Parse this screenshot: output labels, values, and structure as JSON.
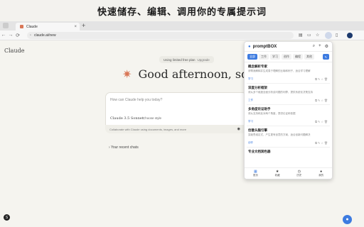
{
  "banner": {
    "headline": "快速储存、编辑、调用你的专属提示词"
  },
  "browser": {
    "tab_title": "Claude",
    "tab_close": "×",
    "new_tab": "+",
    "url": "claude.ai/new",
    "nav": {
      "back": "←",
      "forward": "→",
      "reload": "⟳"
    }
  },
  "claude": {
    "logo": "Claude",
    "plan_text": "Using limited free plan",
    "upgrade": "Upgrade",
    "greeting_star": "✷",
    "greeting": "Good afternoon, sdnvkn",
    "composer_placeholder": "How can Claude help you today?",
    "model": "Claude 3.5 Sonnet",
    "style": "Choose style",
    "collab_text": "Collaborate with Claude using documents, images, and more",
    "recent_chats": "Your recent chats",
    "user_initial": "S"
  },
  "popup": {
    "title": "promptBOX",
    "categories": [
      "全部",
      "工作",
      "学习",
      "创作",
      "编程",
      "其他"
    ],
    "prompts": [
      {
        "title": "概念解析专家",
        "desc": "请帮我解释并生成易于理解的比喻和例子，适合学习理解",
        "tag": "学习"
      },
      {
        "title": "深度分析框架",
        "desc": "请从多个维度全面分析该问题的利弊，提供系统化决策支持",
        "tag": "工作"
      },
      {
        "title": "多角度论证助手",
        "desc": "请从支持和反对两个角度，提供论证和依据",
        "tag": "学习"
      },
      {
        "title": "创意头脑引擎",
        "desc": "突破思维定式，产生更有创意的方案，适合创新问题解决",
        "tag": "创作"
      },
      {
        "title": "专业文档润色器",
        "desc": "",
        "tag": ""
      }
    ],
    "footer": [
      {
        "label": "首页",
        "icon": "▦"
      },
      {
        "label": "收藏",
        "icon": "★"
      },
      {
        "label": "历史",
        "icon": "◷"
      },
      {
        "label": "我的",
        "icon": "●"
      }
    ]
  },
  "colors": {
    "accent": "#3d7be0",
    "claude_orange": "#d97757"
  }
}
